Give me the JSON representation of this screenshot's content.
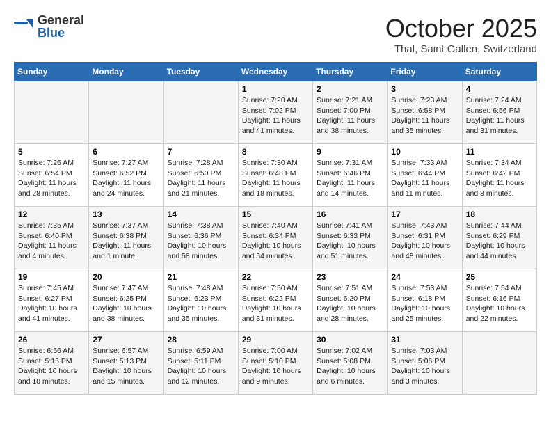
{
  "logo": {
    "general": "General",
    "blue": "Blue"
  },
  "title": "October 2025",
  "location": "Thal, Saint Gallen, Switzerland",
  "weekdays": [
    "Sunday",
    "Monday",
    "Tuesday",
    "Wednesday",
    "Thursday",
    "Friday",
    "Saturday"
  ],
  "weeks": [
    [
      {
        "day": "",
        "info": ""
      },
      {
        "day": "",
        "info": ""
      },
      {
        "day": "",
        "info": ""
      },
      {
        "day": "1",
        "info": "Sunrise: 7:20 AM\nSunset: 7:02 PM\nDaylight: 11 hours and 41 minutes."
      },
      {
        "day": "2",
        "info": "Sunrise: 7:21 AM\nSunset: 7:00 PM\nDaylight: 11 hours and 38 minutes."
      },
      {
        "day": "3",
        "info": "Sunrise: 7:23 AM\nSunset: 6:58 PM\nDaylight: 11 hours and 35 minutes."
      },
      {
        "day": "4",
        "info": "Sunrise: 7:24 AM\nSunset: 6:56 PM\nDaylight: 11 hours and 31 minutes."
      }
    ],
    [
      {
        "day": "5",
        "info": "Sunrise: 7:26 AM\nSunset: 6:54 PM\nDaylight: 11 hours and 28 minutes."
      },
      {
        "day": "6",
        "info": "Sunrise: 7:27 AM\nSunset: 6:52 PM\nDaylight: 11 hours and 24 minutes."
      },
      {
        "day": "7",
        "info": "Sunrise: 7:28 AM\nSunset: 6:50 PM\nDaylight: 11 hours and 21 minutes."
      },
      {
        "day": "8",
        "info": "Sunrise: 7:30 AM\nSunset: 6:48 PM\nDaylight: 11 hours and 18 minutes."
      },
      {
        "day": "9",
        "info": "Sunrise: 7:31 AM\nSunset: 6:46 PM\nDaylight: 11 hours and 14 minutes."
      },
      {
        "day": "10",
        "info": "Sunrise: 7:33 AM\nSunset: 6:44 PM\nDaylight: 11 hours and 11 minutes."
      },
      {
        "day": "11",
        "info": "Sunrise: 7:34 AM\nSunset: 6:42 PM\nDaylight: 11 hours and 8 minutes."
      }
    ],
    [
      {
        "day": "12",
        "info": "Sunrise: 7:35 AM\nSunset: 6:40 PM\nDaylight: 11 hours and 4 minutes."
      },
      {
        "day": "13",
        "info": "Sunrise: 7:37 AM\nSunset: 6:38 PM\nDaylight: 11 hours and 1 minute."
      },
      {
        "day": "14",
        "info": "Sunrise: 7:38 AM\nSunset: 6:36 PM\nDaylight: 10 hours and 58 minutes."
      },
      {
        "day": "15",
        "info": "Sunrise: 7:40 AM\nSunset: 6:34 PM\nDaylight: 10 hours and 54 minutes."
      },
      {
        "day": "16",
        "info": "Sunrise: 7:41 AM\nSunset: 6:33 PM\nDaylight: 10 hours and 51 minutes."
      },
      {
        "day": "17",
        "info": "Sunrise: 7:43 AM\nSunset: 6:31 PM\nDaylight: 10 hours and 48 minutes."
      },
      {
        "day": "18",
        "info": "Sunrise: 7:44 AM\nSunset: 6:29 PM\nDaylight: 10 hours and 44 minutes."
      }
    ],
    [
      {
        "day": "19",
        "info": "Sunrise: 7:45 AM\nSunset: 6:27 PM\nDaylight: 10 hours and 41 minutes."
      },
      {
        "day": "20",
        "info": "Sunrise: 7:47 AM\nSunset: 6:25 PM\nDaylight: 10 hours and 38 minutes."
      },
      {
        "day": "21",
        "info": "Sunrise: 7:48 AM\nSunset: 6:23 PM\nDaylight: 10 hours and 35 minutes."
      },
      {
        "day": "22",
        "info": "Sunrise: 7:50 AM\nSunset: 6:22 PM\nDaylight: 10 hours and 31 minutes."
      },
      {
        "day": "23",
        "info": "Sunrise: 7:51 AM\nSunset: 6:20 PM\nDaylight: 10 hours and 28 minutes."
      },
      {
        "day": "24",
        "info": "Sunrise: 7:53 AM\nSunset: 6:18 PM\nDaylight: 10 hours and 25 minutes."
      },
      {
        "day": "25",
        "info": "Sunrise: 7:54 AM\nSunset: 6:16 PM\nDaylight: 10 hours and 22 minutes."
      }
    ],
    [
      {
        "day": "26",
        "info": "Sunrise: 6:56 AM\nSunset: 5:15 PM\nDaylight: 10 hours and 18 minutes."
      },
      {
        "day": "27",
        "info": "Sunrise: 6:57 AM\nSunset: 5:13 PM\nDaylight: 10 hours and 15 minutes."
      },
      {
        "day": "28",
        "info": "Sunrise: 6:59 AM\nSunset: 5:11 PM\nDaylight: 10 hours and 12 minutes."
      },
      {
        "day": "29",
        "info": "Sunrise: 7:00 AM\nSunset: 5:10 PM\nDaylight: 10 hours and 9 minutes."
      },
      {
        "day": "30",
        "info": "Sunrise: 7:02 AM\nSunset: 5:08 PM\nDaylight: 10 hours and 6 minutes."
      },
      {
        "day": "31",
        "info": "Sunrise: 7:03 AM\nSunset: 5:06 PM\nDaylight: 10 hours and 3 minutes."
      },
      {
        "day": "",
        "info": ""
      }
    ]
  ]
}
